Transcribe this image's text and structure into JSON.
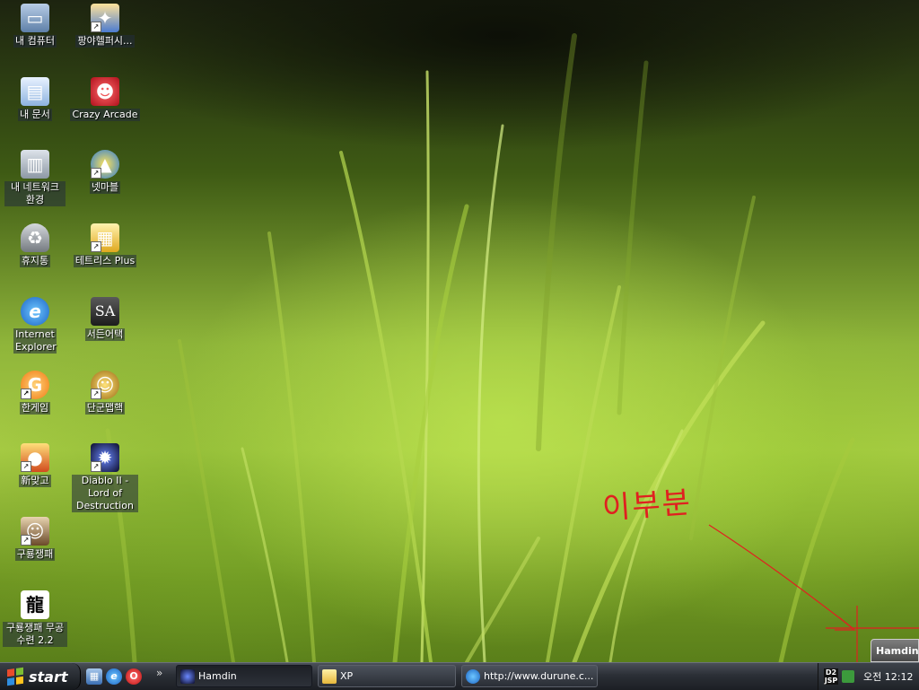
{
  "desktop": {
    "icons_left": [
      {
        "label": "내 컴퓨터",
        "icon": "computer-icon",
        "shortcut": false
      },
      {
        "label": "내 문서",
        "icon": "documents-icon",
        "shortcut": false
      },
      {
        "label": "내 네트워크 환경",
        "icon": "network-icon",
        "shortcut": false
      },
      {
        "label": "휴지통",
        "icon": "recycle-bin-icon",
        "shortcut": false
      },
      {
        "label": "Internet Explorer",
        "icon": "internet-explorer-icon",
        "shortcut": false
      },
      {
        "label": "한게임",
        "icon": "hangame-icon",
        "shortcut": true
      },
      {
        "label": "新맞고",
        "icon": "matgo-icon",
        "shortcut": true
      },
      {
        "label": "구룡쟁패",
        "icon": "guryong-icon",
        "shortcut": true
      },
      {
        "label": "구룡쟁패 무공수련 2.2",
        "icon": "guryong-training-icon",
        "shortcut": false
      }
    ],
    "icons_right": [
      {
        "label": "팡야헬퍼시...",
        "icon": "pangya-helper-icon",
        "shortcut": true
      },
      {
        "label": "Crazy Arcade",
        "icon": "crazy-arcade-icon",
        "shortcut": false
      },
      {
        "label": "넷마블",
        "icon": "netmarble-icon",
        "shortcut": true
      },
      {
        "label": "테트리스 Plus",
        "icon": "tetris-plus-icon",
        "shortcut": true
      },
      {
        "label": "서든어택",
        "icon": "sudden-attack-icon",
        "shortcut": false
      },
      {
        "label": "단군맵핵",
        "icon": "dangun-maphack-icon",
        "shortcut": true
      },
      {
        "label": "Diablo II - Lord of Destruction",
        "icon": "diablo-icon",
        "shortcut": true
      }
    ],
    "annotation_text": "이부분",
    "tooltip": "Hamdin"
  },
  "taskbar": {
    "start_label": "start",
    "quick_launch": [
      "show-desktop-icon",
      "internet-explorer-icon",
      "opera-icon"
    ],
    "tasks": [
      {
        "label": "Hamdin",
        "icon": "hamdin-app-icon",
        "active": true
      },
      {
        "label": "XP",
        "icon": "folder-icon",
        "active": false
      },
      {
        "label": "http://www.durune.c...",
        "icon": "internet-explorer-icon",
        "active": false
      }
    ],
    "tray": {
      "d2_label": "D2\nJSP",
      "clock": "오전 12:12"
    }
  }
}
